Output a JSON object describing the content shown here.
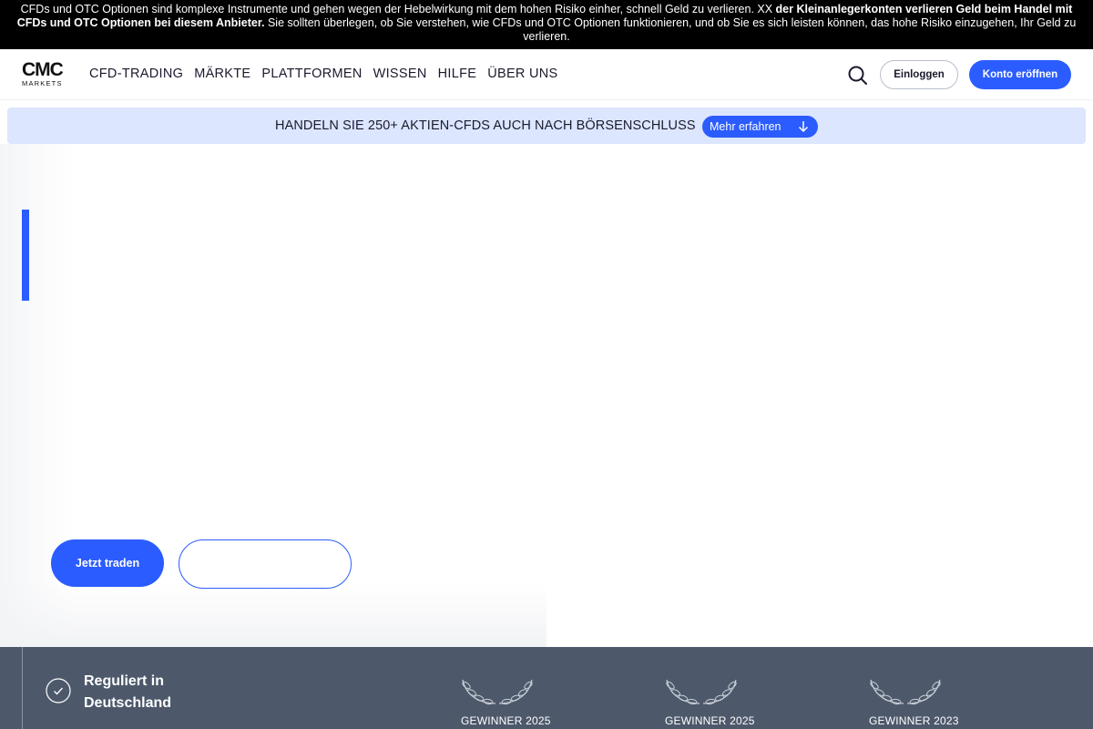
{
  "risk_warning": {
    "text_regular": "CFDs und OTC Optionen sind komplexe Instrumente und gehen wegen der Hebelwirkung mit dem hohen Risiko einher, schnell Geld zu verlieren. XX ",
    "text_bold": "der Kleinanlegerkonten verlieren Geld beim Handel mit CFDs und OTC Optionen bei diesem Anbieter.",
    "text_tail": " Sie sollten überlegen, ob Sie verstehen, wie CFDs und OTC Optionen funktionieren, und ob Sie es sich leisten können, das hohe Risiko einzugehen, Ihr Geld zu verlieren."
  },
  "header": {
    "logo_main": "CMC",
    "logo_sub": "MARKETS",
    "menu": [
      {
        "label": "CFD-TRADING"
      },
      {
        "label": "MÄRKTE"
      },
      {
        "label": "PLATTFORMEN"
      },
      {
        "label": "WISSEN"
      },
      {
        "label": "HILFE"
      },
      {
        "label": "ÜBER UNS"
      }
    ],
    "search_icon": "search-icon",
    "login_label": "Einloggen",
    "open_account_label": "Konto eröffnen"
  },
  "promo": {
    "text": "HANDELN SIE 250+ AKTIEN-CFDS AUCH NACH BÖRSENSCHLUSS",
    "button_label": "Mehr erfahren",
    "button_icon": "arrow-down-icon"
  },
  "hero": {
    "trade_button_label": "Jetzt traden",
    "secondary_button_label": ""
  },
  "footer_strip": {
    "regulated_text": "Reguliert in Deutschland",
    "regulated_icon": "check-circle-icon",
    "awards": [
      {
        "label": "GEWINNER 2025",
        "icon": "laurel-icon"
      },
      {
        "label": "GEWINNER 2025",
        "icon": "laurel-icon"
      },
      {
        "label": "GEWINNER 2023",
        "icon": "laurel-icon"
      }
    ]
  },
  "colors": {
    "accent": "#2b5cff",
    "promo_bg": "#dce6ff",
    "footer_bg": "#4d596b",
    "risk_bg": "#000000"
  }
}
